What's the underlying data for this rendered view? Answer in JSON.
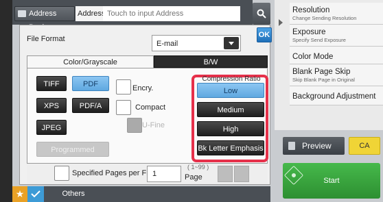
{
  "address_bar": {
    "address_book_label": "Address Book",
    "address_label": "Address",
    "address_placeholder": "Touch to input Address"
  },
  "dialog": {
    "ok_label": "OK",
    "file_format_label": "File Format",
    "file_format_value": "E-mail",
    "tabs": [
      {
        "label": "Color/Grayscale",
        "selected": true
      },
      {
        "label": "B/W",
        "selected": false
      }
    ],
    "format_buttons": [
      {
        "label": "TIFF",
        "selected": false
      },
      {
        "label": "PDF",
        "selected": true
      },
      {
        "label": "XPS",
        "selected": false
      },
      {
        "label": "PDF/A",
        "selected": false
      },
      {
        "label": "JPEG",
        "selected": false
      },
      {
        "label": "Programmed",
        "disabled": true
      }
    ],
    "checkboxes": [
      {
        "label": "Encry.",
        "checked": false,
        "disabled": false
      },
      {
        "label": "Compact",
        "checked": false,
        "disabled": false
      },
      {
        "label": "U-Fine",
        "checked": false,
        "disabled": true
      }
    ],
    "compression": {
      "title": "Compression Ratio",
      "options": [
        {
          "label": "Low",
          "selected": true
        },
        {
          "label": "Medium",
          "selected": false
        },
        {
          "label": "High",
          "selected": false
        },
        {
          "label": "Bk Letter Emphasis",
          "selected": false
        }
      ]
    },
    "specified_pages": {
      "label": "Specified Pages per File",
      "value": "1",
      "range": "( 1~99 )",
      "unit": "Page"
    }
  },
  "bottom_bar": {
    "others_label": "Others"
  },
  "right_menu": {
    "items": [
      {
        "title": "Resolution",
        "subtitle": "Change Sending Resolution"
      },
      {
        "title": "Exposure",
        "subtitle": "Specify Send Exposure"
      },
      {
        "title": "Color Mode",
        "subtitle": ""
      },
      {
        "title": "Blank Page Skip",
        "subtitle": "Skip Blank Page in Original"
      },
      {
        "title": "Background Adjustment",
        "subtitle": ""
      }
    ],
    "preview_label": "Preview",
    "ca_label": "CA",
    "start_label": "Start"
  },
  "colors": {
    "accent_blue": "#5fa8e0",
    "highlight_red": "#e6304a",
    "start_green": "#3aa63f",
    "ca_yellow": "#f0d436",
    "star_orange": "#e9a126"
  }
}
